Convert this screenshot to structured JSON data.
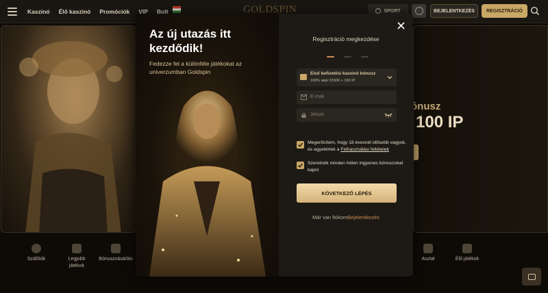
{
  "nav": {
    "links": [
      "Kaszinó",
      "Élő kaszinó",
      "Promóciók",
      "VIP",
      "Bolt"
    ],
    "logo": "GOLDSPIN",
    "sport_label": "SPORT",
    "login_label": "BEJELENTKEZÉS",
    "register_label": "REGISZTRÁCIÓ"
  },
  "hero": {
    "bonus_line1": "ónusz",
    "bonus_line2": "100 IP"
  },
  "categories": [
    {
      "label": "Szállítók"
    },
    {
      "label": "Legjobb\njátékok"
    },
    {
      "label": "Bónuszvásárlás"
    },
    {
      "label": "Asztal"
    },
    {
      "label": "Élő játékok"
    }
  ],
  "modal": {
    "title": "Az új utazás itt kezdődik!",
    "subtitle": "Fedezze fel a különféle játékokat az univerzumban Goldspin",
    "form_title": "Regisztráció megkezdése",
    "steps_total": 3,
    "step_current": 1,
    "bonus": {
      "title": "Első befizetési kaszinó bónusz",
      "detail": "100% akár €1500 + 100 IP"
    },
    "email_placeholder": "E-mail",
    "password_placeholder": "Jelszó",
    "age_check": {
      "text": "Megerősítem, hogy 18 évesnél idősebb vagyok, és egyetértek a ",
      "link": "Felhasználási feltételek",
      "checked": true
    },
    "promo_check": {
      "text": "Szeretnék minden héten ingyenes bónuszokat kapni",
      "checked": true
    },
    "next_label": "KÖVETKEZŐ LÉPÉS",
    "have_account_text": "Már van fiókom",
    "have_account_link": "Bejelentkezés"
  },
  "colors": {
    "accent_gold": "#c9a766",
    "link_orange": "#c98e57",
    "panel": "#1d1a15"
  }
}
